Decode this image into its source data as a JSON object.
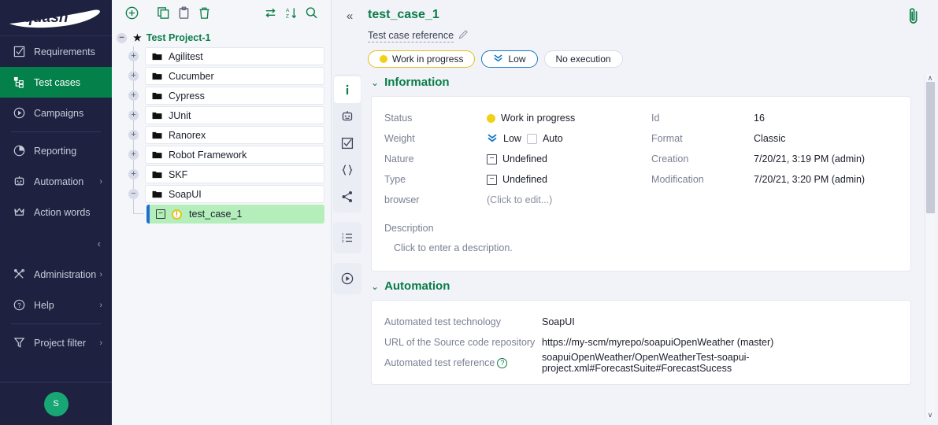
{
  "brand": {
    "name": "squash",
    "accent": "#04814b",
    "nav_bg": "#1e2140"
  },
  "sidebar": {
    "items": [
      {
        "label": "Requirements",
        "icon": "checkbox-icon",
        "active": false,
        "chevron": ""
      },
      {
        "label": "Test cases",
        "icon": "tree-nodes-icon",
        "active": true,
        "chevron": ""
      },
      {
        "label": "Campaigns",
        "icon": "play-circle-icon",
        "active": false,
        "chevron": ""
      },
      {
        "label": "Reporting",
        "icon": "pie-chart-icon",
        "active": false,
        "chevron": ""
      },
      {
        "label": "Automation",
        "icon": "robot-icon",
        "active": false,
        "chevron": "›"
      },
      {
        "label": "Action words",
        "icon": "crown-icon",
        "active": false,
        "chevron": ""
      },
      {
        "label": "Administration",
        "icon": "tools-icon",
        "active": false,
        "chevron": "›"
      },
      {
        "label": "Help",
        "icon": "question-circle-icon",
        "active": false,
        "chevron": "›"
      },
      {
        "label": "Project filter",
        "icon": "funnel-icon",
        "active": false,
        "chevron": "›"
      }
    ],
    "collapse_glyph": "‹",
    "avatar_initial": "S"
  },
  "tree": {
    "toolbar": [
      {
        "name": "add-icon",
        "glyph": "plus-circle"
      },
      {
        "name": "copy-icon",
        "glyph": "copy"
      },
      {
        "name": "paste-icon",
        "glyph": "clipboard"
      },
      {
        "name": "delete-icon",
        "glyph": "trash"
      },
      {
        "name": "transfer-icon",
        "glyph": "arrows"
      },
      {
        "name": "sort-icon",
        "glyph": "az-sort"
      },
      {
        "name": "search-icon",
        "glyph": "magnifier"
      }
    ],
    "root": {
      "label": "Test Project-1",
      "twist": "−"
    },
    "folders": [
      {
        "label": "Agilitest",
        "twist": "+"
      },
      {
        "label": "Cucumber",
        "twist": "+"
      },
      {
        "label": "Cypress",
        "twist": "+"
      },
      {
        "label": "JUnit",
        "twist": "+"
      },
      {
        "label": "Ranorex",
        "twist": "+"
      },
      {
        "label": "Robot Framework",
        "twist": "+"
      },
      {
        "label": "SKF",
        "twist": "+"
      },
      {
        "label": "SoapUI",
        "twist": "−"
      }
    ],
    "selected_node": {
      "label": "test_case_1",
      "twist": "−",
      "status_glyph": "!"
    }
  },
  "header": {
    "collapse_glyph": "«",
    "title": "test_case_1",
    "reference_label": "Test case reference",
    "attachment_icon": "paperclip-icon",
    "chips": [
      {
        "label": "Work in progress",
        "kind": "status"
      },
      {
        "label": "Low",
        "kind": "weight"
      },
      {
        "label": "No execution",
        "kind": "execution"
      }
    ]
  },
  "vrail": {
    "group1": [
      {
        "name": "information-tab",
        "glyph": "i",
        "active": true
      },
      {
        "name": "automation-tab",
        "glyph": "robot",
        "active": false
      },
      {
        "name": "test-steps-tab",
        "glyph": "checkbox",
        "active": false
      },
      {
        "name": "parameters-tab",
        "glyph": "braces",
        "active": false
      },
      {
        "name": "linked-items-tab",
        "glyph": "share",
        "active": false
      }
    ],
    "group2": [
      {
        "name": "test-steps-list-tab",
        "glyph": "list",
        "active": false
      }
    ],
    "group3": [
      {
        "name": "executions-tab",
        "glyph": "play-circle",
        "active": false
      }
    ]
  },
  "information": {
    "section_title": "Information",
    "caret": "⌄",
    "left": [
      {
        "label": "Status",
        "value": "Work in progress",
        "icon": "yellow-dot"
      },
      {
        "label": "Weight",
        "value": "Low",
        "icon": "chevrons-down",
        "extra": "Auto"
      },
      {
        "label": "Nature",
        "value": "Undefined",
        "icon": "minus-box"
      },
      {
        "label": "Type",
        "value": "Undefined",
        "icon": "minus-box"
      },
      {
        "label": "browser",
        "value": "(Click to edit...)",
        "icon": ""
      }
    ],
    "right": [
      {
        "label": "Id",
        "value": "16"
      },
      {
        "label": "Format",
        "value": "Classic"
      },
      {
        "label": "Creation",
        "value": "7/20/21, 3:19 PM (admin)"
      },
      {
        "label": "Modification",
        "value": "7/20/21, 3:20 PM (admin)"
      }
    ],
    "description_label": "Description",
    "description_placeholder": "Click to enter a description."
  },
  "automation": {
    "section_title": "Automation",
    "caret": "⌄",
    "rows": [
      {
        "label": "Automated test technology",
        "value": "SoapUI",
        "help": false
      },
      {
        "label": "URL of the Source code repository",
        "value": "https://my-scm/myrepo/soapuiOpenWeather (master)",
        "help": false
      },
      {
        "label": "Automated test reference",
        "value": "soapuiOpenWeather/OpenWeatherTest-soapui-project.xml#ForecastSuite#ForecastSucess",
        "help": true
      }
    ]
  },
  "scrollbar": {
    "up": "∧",
    "down": "∨"
  }
}
